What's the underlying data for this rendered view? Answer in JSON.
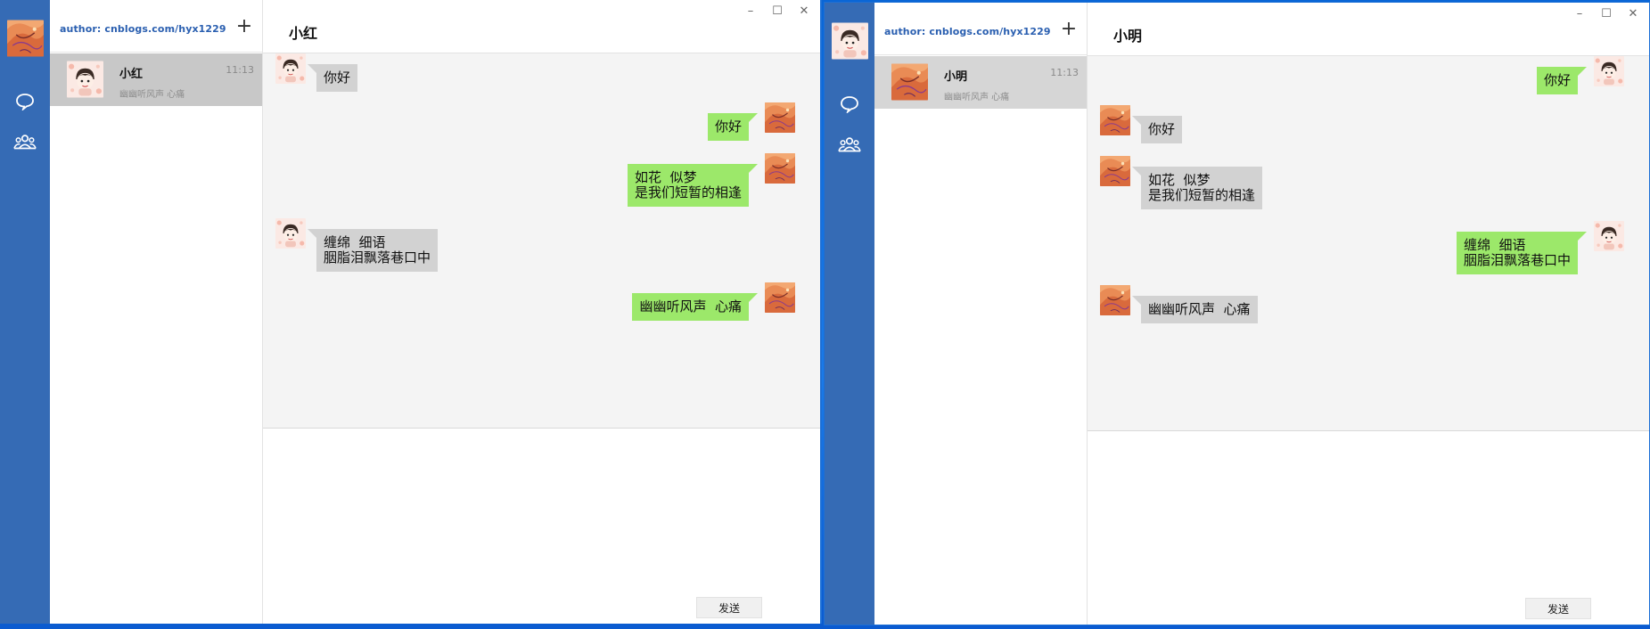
{
  "colors": {
    "rail": "#356bb5",
    "sent_bubble": "#9ce86a",
    "recv_bubble": "#d2d2d2",
    "chat_bg": "#f4f4f4",
    "conv_selected": "#c8c8c8",
    "author_link": "#2a5fb0"
  },
  "windows": [
    {
      "author": "author: cnblogs.com/hyx1229",
      "add_icon": "+",
      "nav": {
        "chat_icon": "chat-bubble-icon",
        "contacts_icon": "contacts-icon"
      },
      "conversation": {
        "name": "小红",
        "time": "11:13",
        "preview": "幽幽听风声 心痛"
      },
      "chat_title": "小红",
      "window_controls": {
        "minimize": "–",
        "maximize": "☐",
        "close": "✕"
      },
      "messages": [
        {
          "side": "left",
          "text": "你好"
        },
        {
          "side": "right",
          "text": "你好"
        },
        {
          "side": "right",
          "text": "如花  似梦\n是我们短暂的相逢"
        },
        {
          "side": "left",
          "text": "缠绵  细语\n胭脂泪飘落巷口中"
        },
        {
          "side": "right",
          "text": "幽幽听风声  心痛"
        }
      ],
      "send_label": "发送"
    },
    {
      "author": "author: cnblogs.com/hyx1229",
      "add_icon": "+",
      "nav": {
        "chat_icon": "chat-bubble-icon",
        "contacts_icon": "contacts-icon"
      },
      "conversation": {
        "name": "小明",
        "time": "11:13",
        "preview": "幽幽听风声 心痛"
      },
      "chat_title": "小明",
      "window_controls": {
        "minimize": "–",
        "maximize": "☐",
        "close": "✕"
      },
      "messages": [
        {
          "side": "right",
          "text": "你好"
        },
        {
          "side": "left",
          "text": "你好"
        },
        {
          "side": "left",
          "text": "如花  似梦\n是我们短暂的相逢"
        },
        {
          "side": "right",
          "text": "缠绵  细语\n胭脂泪飘落巷口中"
        },
        {
          "side": "left",
          "text": "幽幽听风声  心痛"
        }
      ],
      "send_label": "发送"
    }
  ]
}
